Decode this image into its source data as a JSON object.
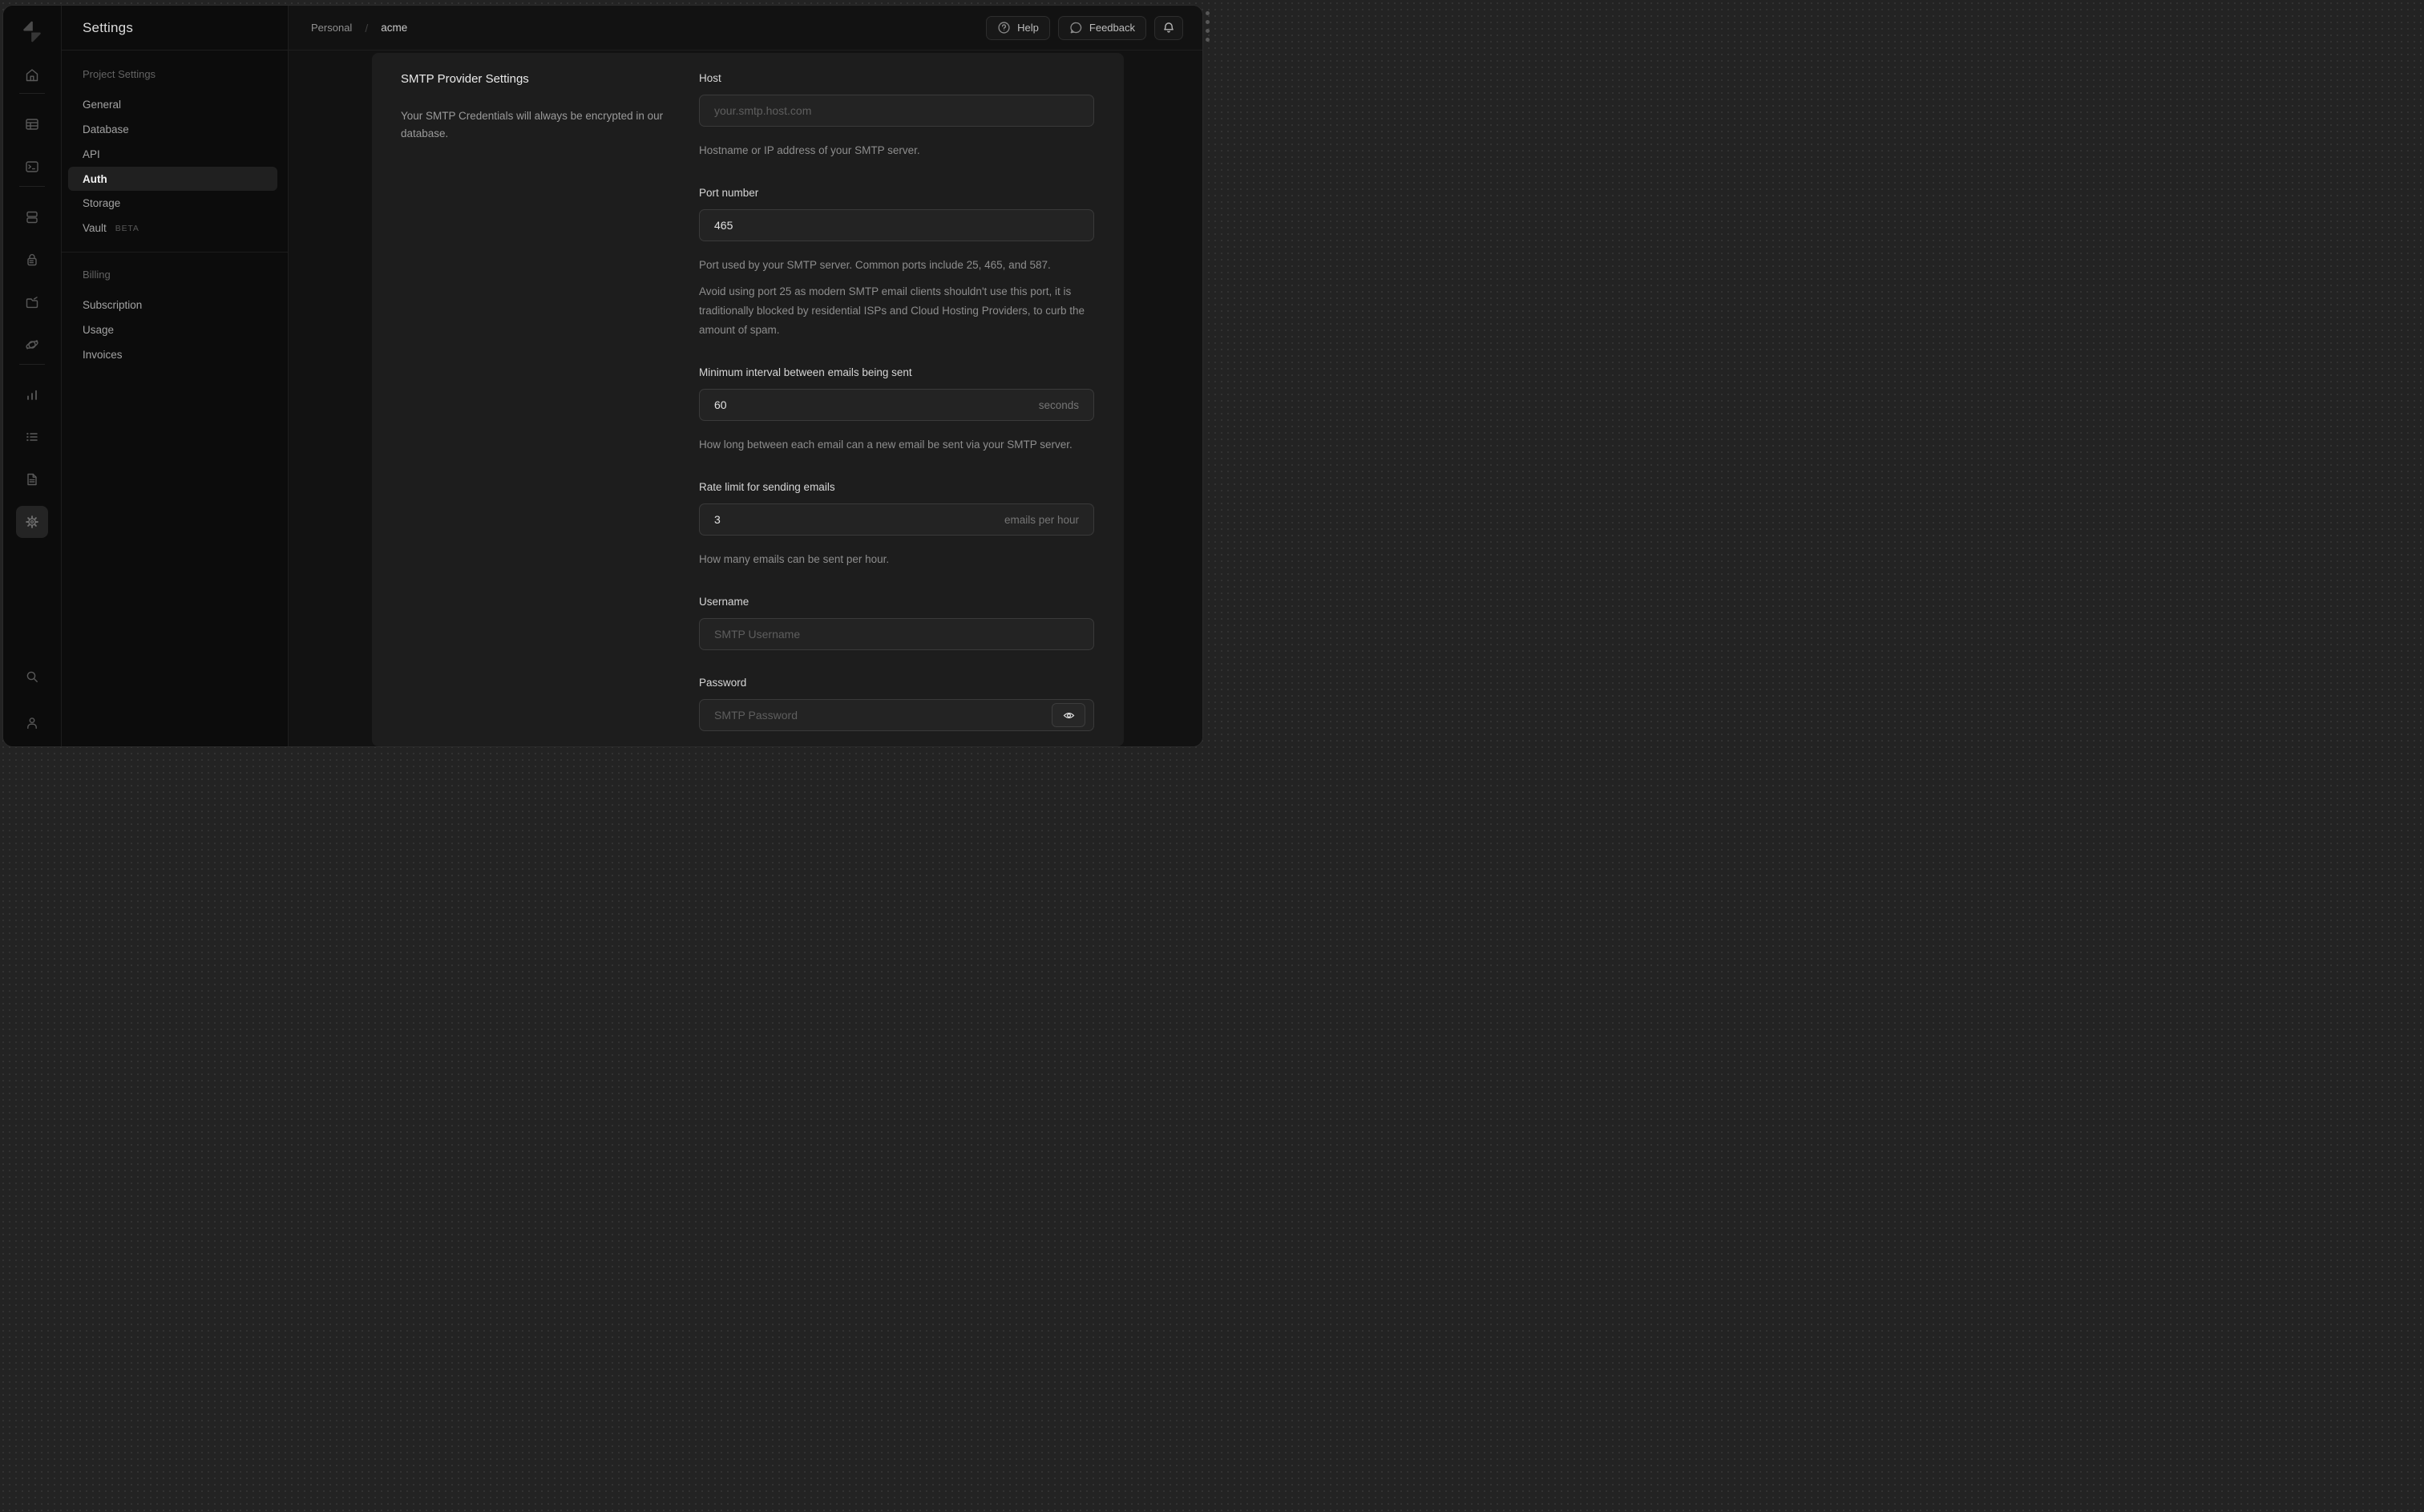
{
  "colors": {
    "outer_bg": "#232323",
    "window_bg": "#0e0e0e",
    "sidebar_bg": "#0c0c0c",
    "content_bg": "#121212",
    "panel_bg": "#1d1d1d",
    "input_bg": "#232323",
    "input_border": "#3a3a3a",
    "selected_text": "#f2f2f2",
    "muted_text": "#8d8d8d"
  },
  "rail": {
    "logo_icon": "supabase-bolt-logo",
    "icons": [
      "home",
      "table-editor",
      "sql-editor",
      "database",
      "auth",
      "storage",
      "edge-functions",
      "reports",
      "logs",
      "docs",
      "settings",
      "search",
      "profile"
    ],
    "selected": "settings"
  },
  "sidebar": {
    "title": "Settings",
    "sections": [
      {
        "label": "Project Settings",
        "items": [
          {
            "label": "General"
          },
          {
            "label": "Database"
          },
          {
            "label": "API"
          },
          {
            "label": "Auth",
            "selected": true
          },
          {
            "label": "Storage"
          },
          {
            "label": "Vault",
            "badge": "BETA"
          }
        ]
      },
      {
        "label": "Billing",
        "items": [
          {
            "label": "Subscription"
          },
          {
            "label": "Usage"
          },
          {
            "label": "Invoices"
          }
        ]
      }
    ]
  },
  "topbar": {
    "breadcrumb": {
      "org": "Personal",
      "separator": "/",
      "project": "acme"
    },
    "help_label": "Help",
    "feedback_label": "Feedback",
    "icons": [
      "help-circle",
      "chat-bubble",
      "bell"
    ]
  },
  "panel": {
    "title": "SMTP Provider Settings",
    "description": "Your SMTP Credentials will always be encrypted in our database.",
    "fields": {
      "host": {
        "label": "Host",
        "placeholder": "your.smtp.host.com",
        "helper": "Hostname or IP address of your SMTP server."
      },
      "port": {
        "label": "Port number",
        "value": "465",
        "helper1": "Port used by your SMTP server. Common ports include 25, 465, and 587.",
        "helper2": "Avoid using port 25 as modern SMTP email clients shouldn't use this port, it is traditionally blocked by residential ISPs and Cloud Hosting Providers, to curb the amount of spam."
      },
      "interval": {
        "label": "Minimum interval between emails being sent",
        "value": "60",
        "suffix": "seconds",
        "helper": "How long between each email can a new email be sent via your SMTP server."
      },
      "rate": {
        "label": "Rate limit for sending emails",
        "value": "3",
        "suffix": "emails per hour",
        "helper": "How many emails can be sent per hour."
      },
      "username": {
        "label": "Username",
        "placeholder": "SMTP Username"
      },
      "password": {
        "label": "Password",
        "placeholder": "SMTP Password",
        "toggle_icon": "eye"
      }
    }
  }
}
